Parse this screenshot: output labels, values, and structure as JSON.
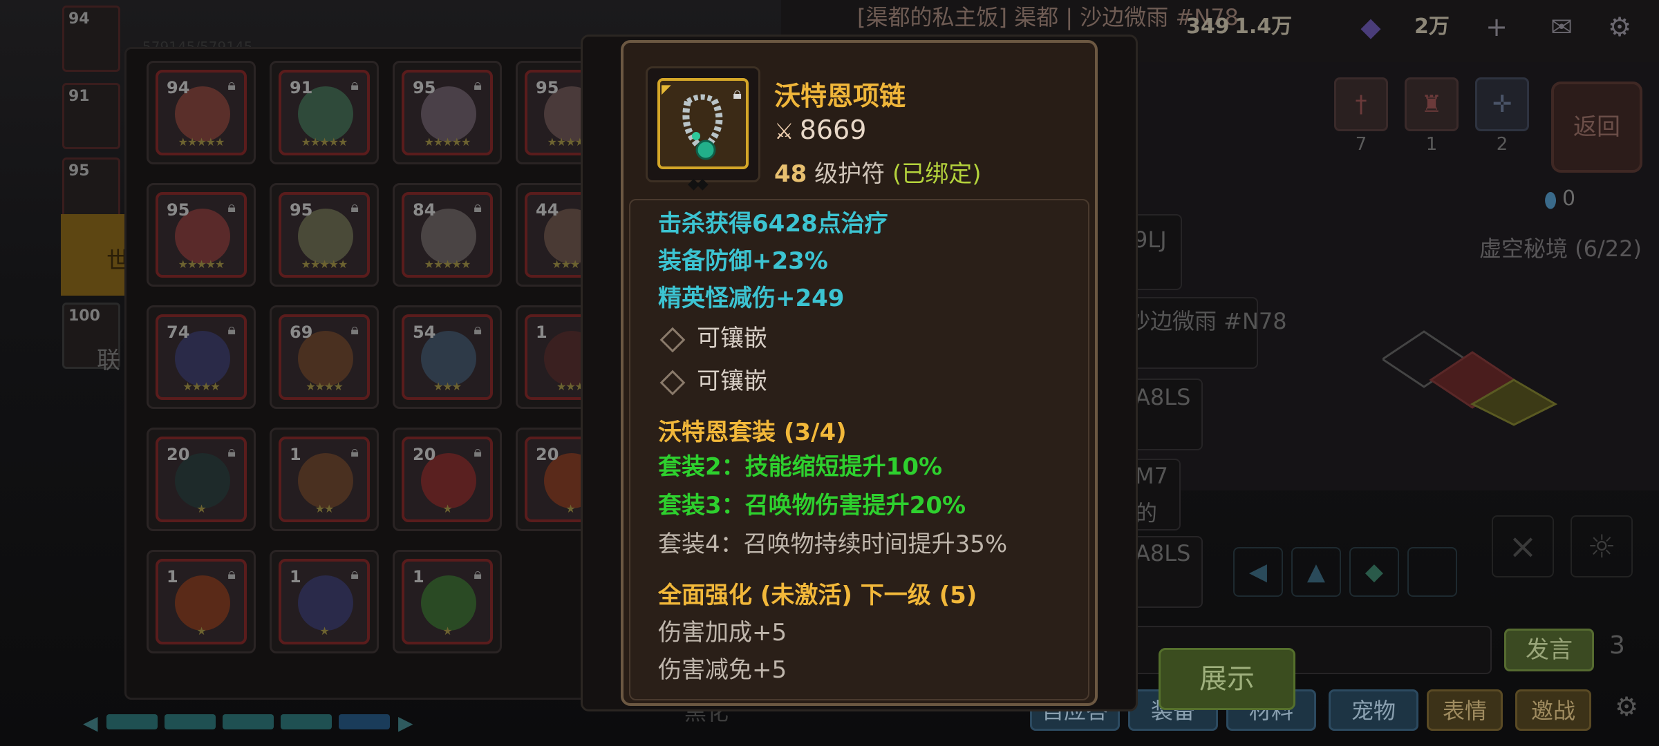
{
  "top_bar": {
    "channel_title": "[渠都的私主饭] 渠都 | 沙边微雨 #N78",
    "currency_1": "1.4万",
    "currency_2": "2万",
    "plus_icon": "plus-icon",
    "mail_icon": "mail-icon",
    "settings_icon": "gear-icon",
    "partial_number": "349"
  },
  "right_panel": {
    "back_label": "返回",
    "stat_counts": [
      "7",
      "1",
      "2"
    ],
    "gem_count": "0",
    "void_realm": "虚空秘境 (6/22)"
  },
  "chat_fragments": {
    "line_1": "9LJ",
    "line_2": "沙边微雨 #N78",
    "line_3": "A8LS",
    "line_4": "M7",
    "line_5": "的",
    "line_6": "A8LS",
    "bottom_left": "黑化"
  },
  "bottom_buttons": {
    "speak": "发言",
    "show": "展示",
    "channel_count": "3",
    "tabs": [
      "自应答",
      "装备",
      "材料",
      "宠物",
      "表情",
      "邀战"
    ]
  },
  "heroes": [
    {
      "level": "94",
      "stars": "★★★★★",
      "color": "#5a2f2a"
    },
    {
      "level": "91",
      "stars": "★★★★★",
      "color": "#2f4a3a"
    },
    {
      "level": "95",
      "stars": "★★★★★",
      "color": "#4a4048"
    },
    {
      "level": "95",
      "stars": "★★★★★",
      "color": "#4a3a3a"
    },
    {
      "level": "95",
      "stars": "★★★★★",
      "color": "#5a2a2a"
    },
    {
      "level": "95",
      "stars": "★★★★★",
      "color": "#4a4a38"
    },
    {
      "level": "84",
      "stars": "★★★★★",
      "color": "#4a4444"
    },
    {
      "level": "44",
      "stars": "★★★★",
      "color": "#4a3a34"
    },
    {
      "level": "74",
      "stars": "★★★★",
      "color": "#2a2a48"
    },
    {
      "level": "69",
      "stars": "★★★★",
      "color": "#4a3020"
    },
    {
      "level": "54",
      "stars": "★★★",
      "color": "#2e3a48"
    },
    {
      "level": "1",
      "stars": "★★★",
      "color": "#3a2020"
    },
    {
      "level": "20",
      "stars": "★",
      "color": "#1e2a2a"
    },
    {
      "level": "1",
      "stars": "★★",
      "color": "#4a3020"
    },
    {
      "level": "20",
      "stars": "★",
      "color": "#5a2020"
    },
    {
      "level": "20",
      "stars": "★",
      "color": "#5a2a1a"
    },
    {
      "level": "1",
      "stars": "★",
      "color": "#5a2a18"
    },
    {
      "level": "1",
      "stars": "★",
      "color": "#2a2a4a"
    },
    {
      "level": "1",
      "stars": "★",
      "color": "#2a4a24"
    }
  ],
  "side_list": [
    {
      "level": "94"
    },
    {
      "level": "91"
    },
    {
      "level": "95"
    },
    {
      "level": "100"
    }
  ],
  "side_labels": {
    "gold_tab": "世",
    "alliance": "联",
    "hp": "579145/579145"
  },
  "item": {
    "name": "沃特恩项链",
    "power": "8669",
    "level": "48",
    "type": "级护符",
    "bound": "(已绑定)",
    "lock_icon": "lock-icon",
    "icon": "necklace-icon"
  },
  "item_stats": [
    "击杀获得6428点治疗",
    "装备防御+23%",
    "精英怪减伤+249"
  ],
  "sockets": [
    "可镶嵌",
    "可镶嵌"
  ],
  "set_bonus": {
    "title": "沃特恩套装 (3/4)",
    "lines": [
      {
        "text": "套装2：技能缩短提升10%",
        "active": true
      },
      {
        "text": "套装3：召唤物伤害提升20%",
        "active": true
      },
      {
        "text": "套装4：召唤物持续时间提升35%",
        "active": false
      }
    ]
  },
  "enhance": {
    "title": "全面强化 (未激活) 下一级 (5)",
    "lines": [
      "伤害加成+5",
      "伤害减免+5"
    ]
  },
  "colors": {
    "tooltip_border": "#6c5842",
    "name_gold": "#f0b63a",
    "stat_cyan": "#3cc4d2",
    "set_green": "#2ed02e",
    "bound_green": "#b4d23c"
  }
}
